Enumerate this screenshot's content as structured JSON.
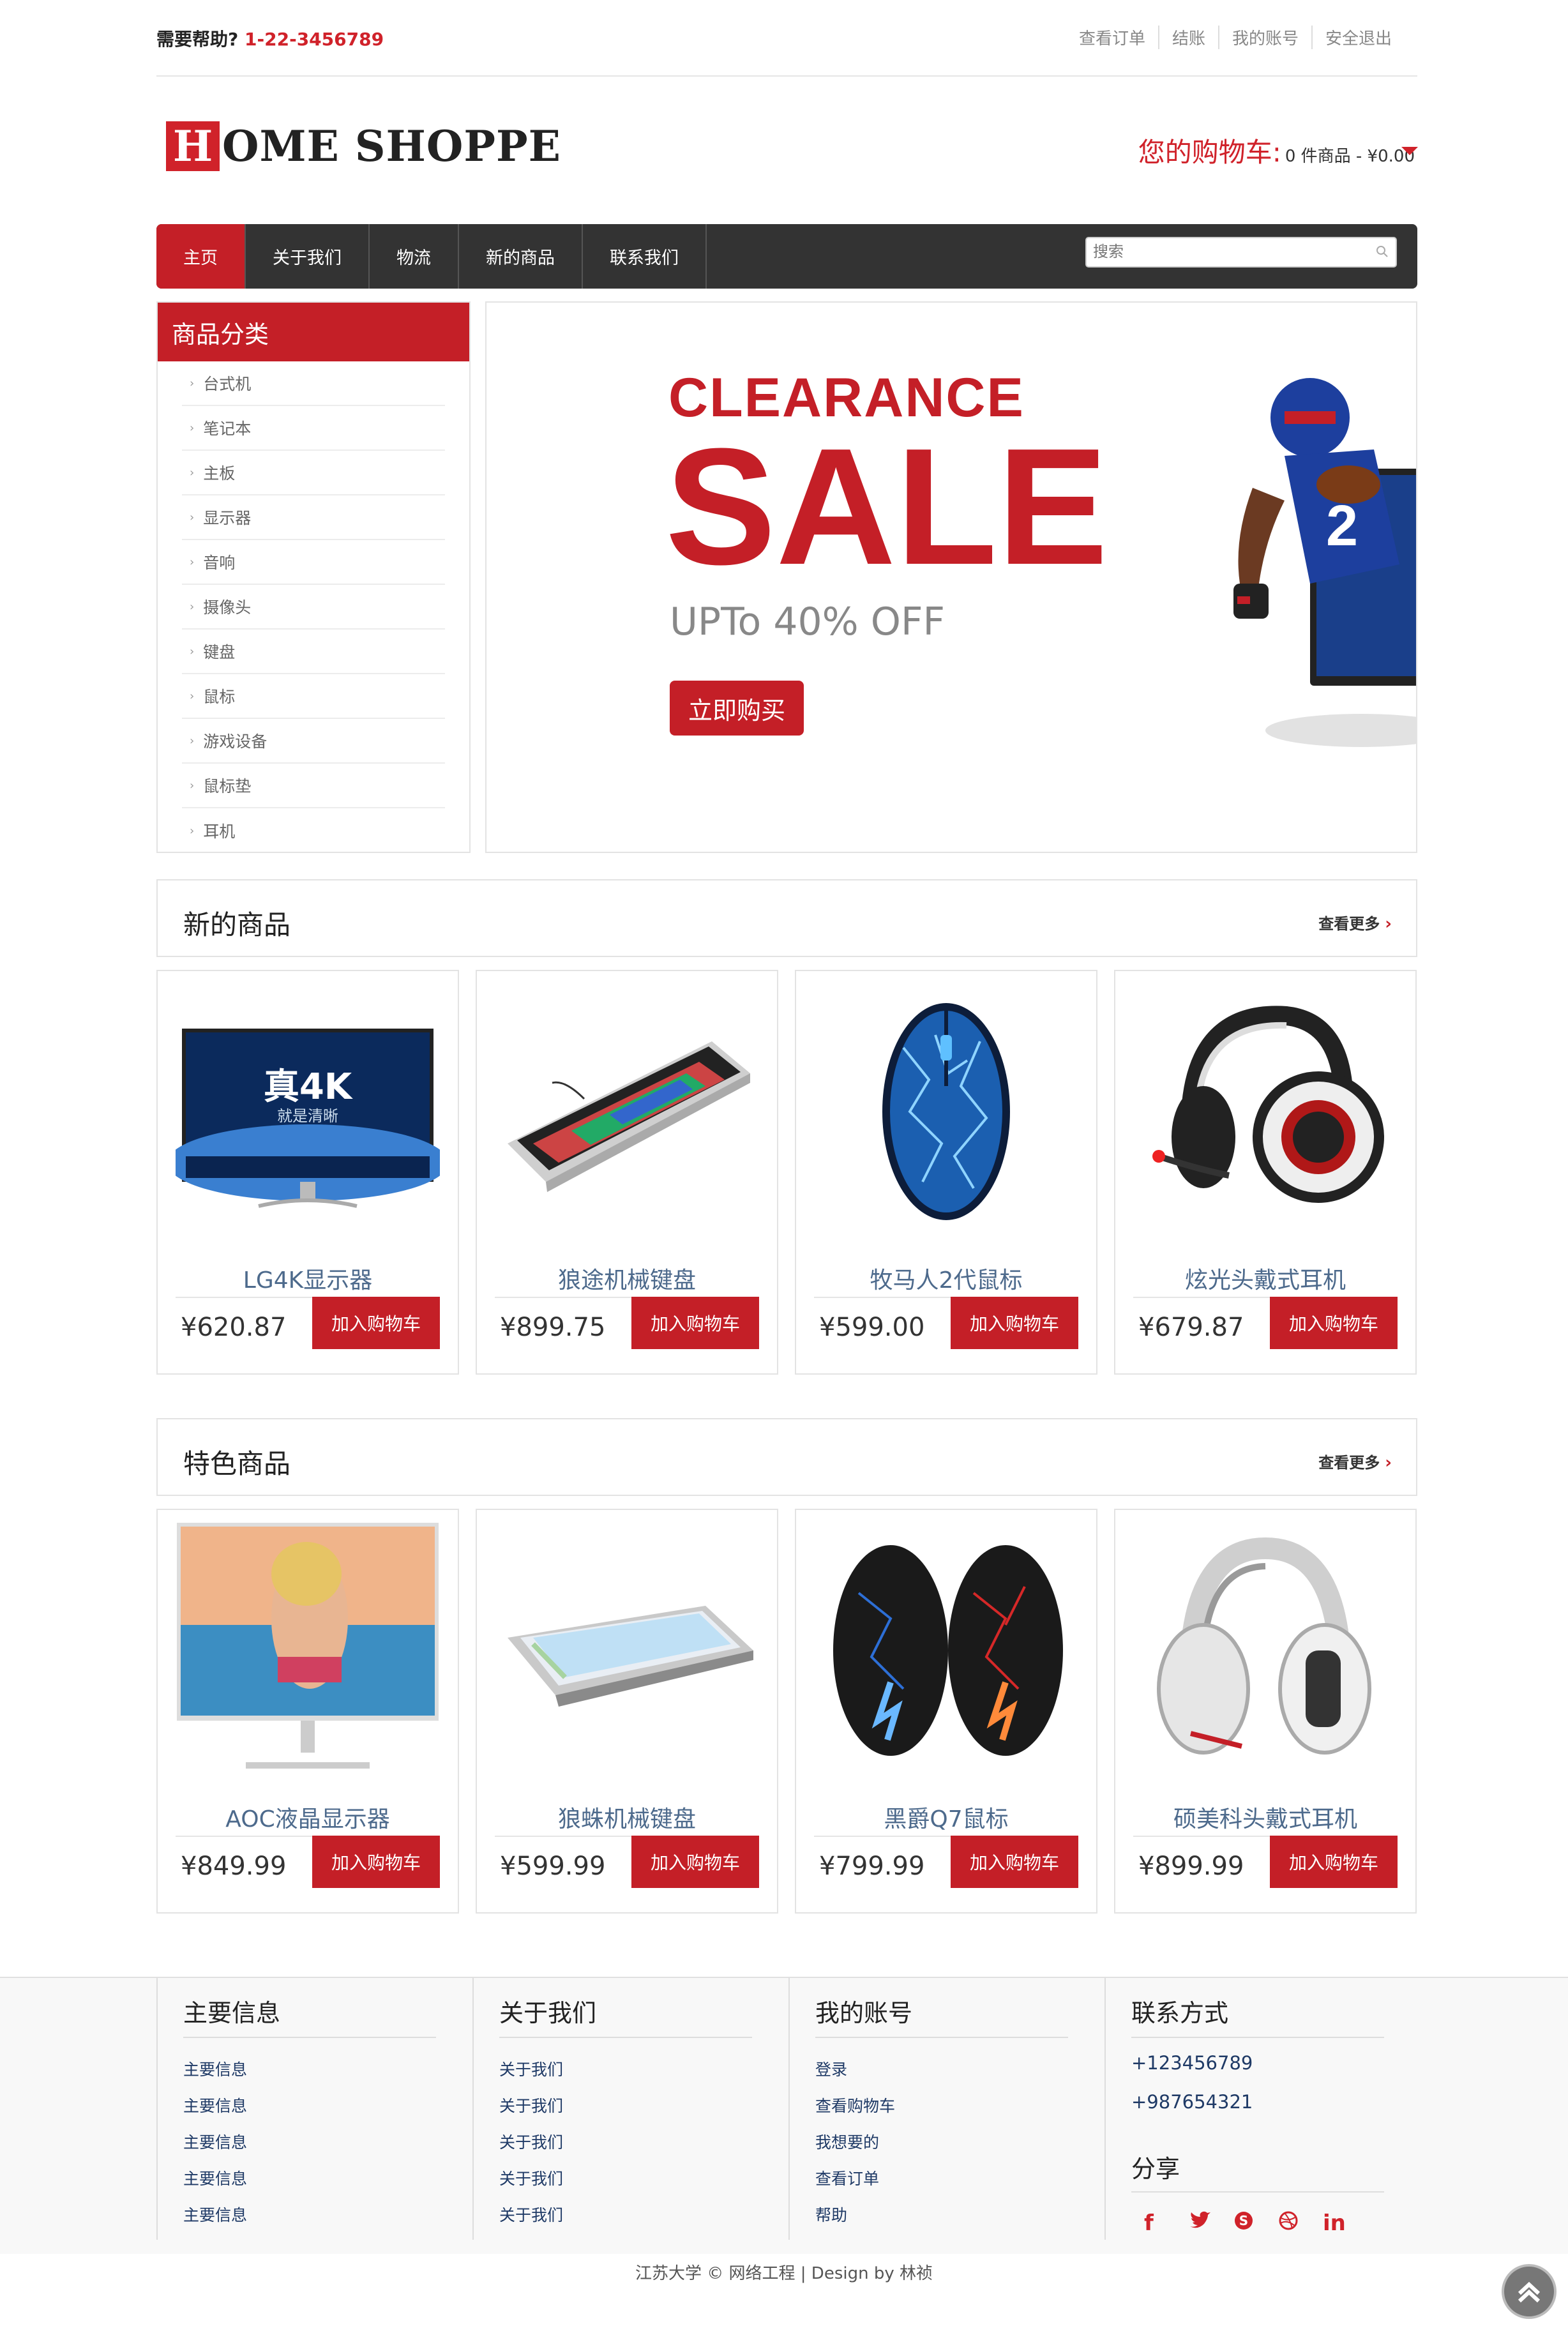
{
  "topbar": {
    "help_label": "需要帮助? ",
    "phone": "1-22-3456789",
    "links": [
      "查看订单",
      "结账",
      "我的账号",
      "安全退出"
    ]
  },
  "logo": {
    "initial": "H",
    "rest": "OME SHOPPE"
  },
  "cart": {
    "label": "您的购物车:",
    "info": "0 件商品 - ¥0.00"
  },
  "nav": {
    "items": [
      "主页",
      "关于我们",
      "物流",
      "新的商品",
      "联系我们"
    ],
    "active": 0
  },
  "search": {
    "placeholder": "搜索"
  },
  "sidebar": {
    "title": "商品分类",
    "items": [
      "台式机",
      "笔记本",
      "主板",
      "显示器",
      "音响",
      "摄像头",
      "键盘",
      "鼠标",
      "游戏设备",
      "鼠标垫",
      "耳机"
    ]
  },
  "banner": {
    "line1": "CLEARANCE",
    "line2": "SALE",
    "line3": "UPTo 40% OFF",
    "button": "立即购买"
  },
  "new_products": {
    "title": "新的商品",
    "more": "查看更多",
    "items": [
      {
        "name": "LG4K显示器",
        "price": "¥620.87",
        "button": "加入购物车",
        "img_text1": "真4K",
        "img_text2": "就是清晰"
      },
      {
        "name": "狼途机械键盘",
        "price": "¥899.75",
        "button": "加入购物车"
      },
      {
        "name": "牧马人2代鼠标",
        "price": "¥599.00",
        "button": "加入购物车"
      },
      {
        "name": "炫光头戴式耳机",
        "price": "¥679.87",
        "button": "加入购物车"
      }
    ]
  },
  "featured_products": {
    "title": "特色商品",
    "more": "查看更多",
    "items": [
      {
        "name": "AOC液晶显示器",
        "price": "¥849.99",
        "button": "加入购物车"
      },
      {
        "name": "狼蛛机械键盘",
        "price": "¥599.99",
        "button": "加入购物车"
      },
      {
        "name": "黑爵Q7鼠标",
        "price": "¥799.99",
        "button": "加入购物车"
      },
      {
        "name": "硕美科头戴式耳机",
        "price": "¥899.99",
        "button": "加入购物车"
      }
    ]
  },
  "footer": {
    "col1": {
      "title": "主要信息",
      "items": [
        "主要信息",
        "主要信息",
        "主要信息",
        "主要信息",
        "主要信息"
      ]
    },
    "col2": {
      "title": "关于我们",
      "items": [
        "关于我们",
        "关于我们",
        "关于我们",
        "关于我们",
        "关于我们"
      ]
    },
    "col3": {
      "title": "我的账号",
      "items": [
        "登录",
        "查看购物车",
        "我想要的",
        "查看订单",
        "帮助"
      ]
    },
    "col4": {
      "title": "联系方式",
      "items": [
        "+123456789",
        "+987654321"
      ],
      "share_title": "分享"
    },
    "copyright": "江苏大学 © 网络工程 | Design by 林祯"
  },
  "colors": {
    "accent": "#c41f27",
    "nav_bg": "#333333",
    "link_blue": "#1f3a66"
  }
}
